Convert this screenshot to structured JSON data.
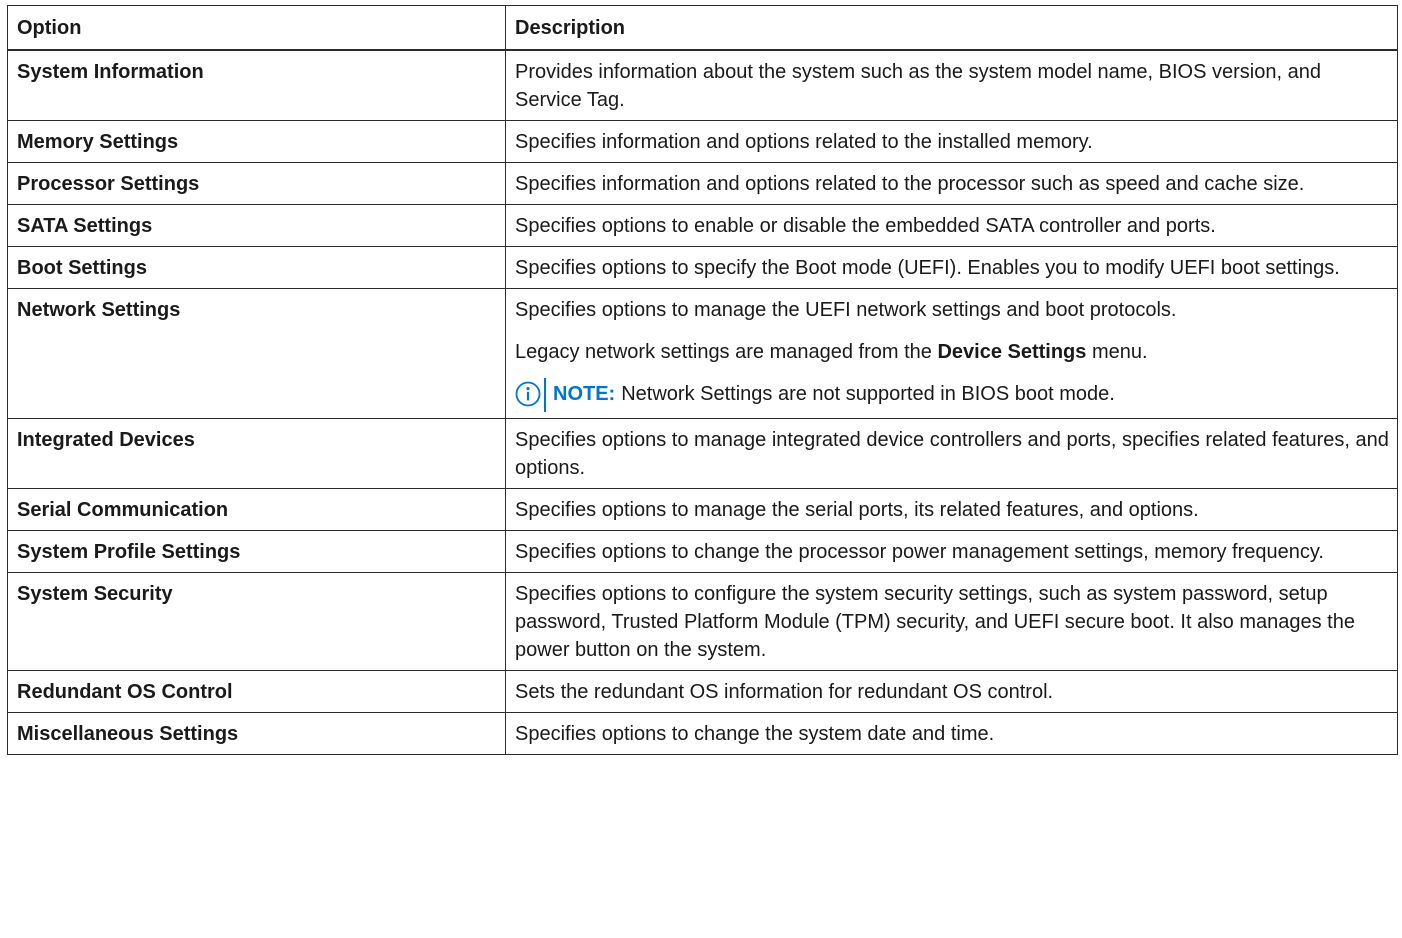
{
  "headers": {
    "option": "Option",
    "description": "Description"
  },
  "rows": [
    {
      "option": "System Information",
      "description": "Provides information about the system such as the system model name, BIOS version, and Service Tag."
    },
    {
      "option": "Memory Settings",
      "description": "Specifies information and options related to the installed memory."
    },
    {
      "option": "Processor Settings",
      "description": "Specifies information and options related to the processor such as speed and cache size."
    },
    {
      "option": "SATA Settings",
      "description": "Specifies options to enable or disable the embedded SATA controller and ports."
    },
    {
      "option": "Boot Settings",
      "description": "Specifies options to specify the Boot mode (UEFI). Enables you to modify UEFI boot settings."
    },
    {
      "option": "Network Settings",
      "description": "Specifies options to manage the UEFI network settings and boot protocols.",
      "legacy_prefix": "Legacy network settings are managed from the ",
      "legacy_bold": "Device Settings",
      "legacy_suffix": " menu.",
      "note_icon": "info-circle-icon",
      "note_label": "NOTE:",
      "note_text": "Network Settings are not supported in BIOS boot mode."
    },
    {
      "option": "Integrated Devices",
      "description": "Specifies options to manage integrated device controllers and ports, specifies related features, and options."
    },
    {
      "option": "Serial Communication",
      "description": "Specifies options to manage the serial ports, its related features, and options."
    },
    {
      "option": "System Profile Settings",
      "description": "Specifies options to change the processor power management settings, memory frequency."
    },
    {
      "option": "System Security",
      "description": "Specifies options to configure the system security settings, such as system password, setup password, Trusted Platform Module (TPM) security, and UEFI secure boot. It also manages the power button on the system."
    },
    {
      "option": "Redundant OS Control",
      "description": "Sets the redundant OS information for redundant OS control."
    },
    {
      "option": "Miscellaneous Settings",
      "description": "Specifies options to change the system date and time."
    }
  ],
  "colors": {
    "note_accent": "#0076ce",
    "border": "#2b2b2b",
    "text": "#1a1a1a"
  }
}
